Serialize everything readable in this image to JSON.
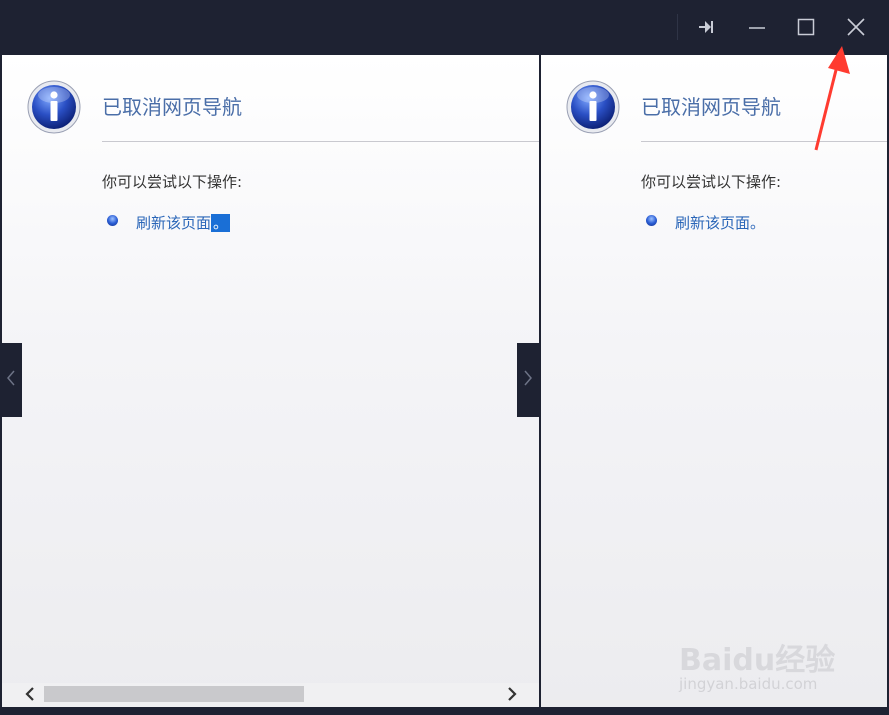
{
  "titlebar": {
    "buttons": [
      {
        "name": "pin-icon"
      },
      {
        "name": "minimize-icon"
      },
      {
        "name": "maximize-icon"
      },
      {
        "name": "close-icon"
      }
    ]
  },
  "panes": [
    {
      "title": "已取消网页导航",
      "try_label": "你可以尝试以下操作:",
      "refresh_link": "刷新该页面",
      "refresh_suffix": "。",
      "suffix_selected": true
    },
    {
      "title": "已取消网页导航",
      "try_label": "你可以尝试以下操作:",
      "refresh_link": "刷新该页面",
      "refresh_suffix": "。",
      "suffix_selected": false
    }
  ],
  "watermark": {
    "brand": "Baidu经验",
    "url": "jingyan.baidu.com"
  },
  "colors": {
    "frame": "#1e2232",
    "title_text": "#4a6ea8",
    "link": "#2a66b8",
    "selection": "#1a6fd6",
    "annotation_arrow": "#ff3b30"
  }
}
